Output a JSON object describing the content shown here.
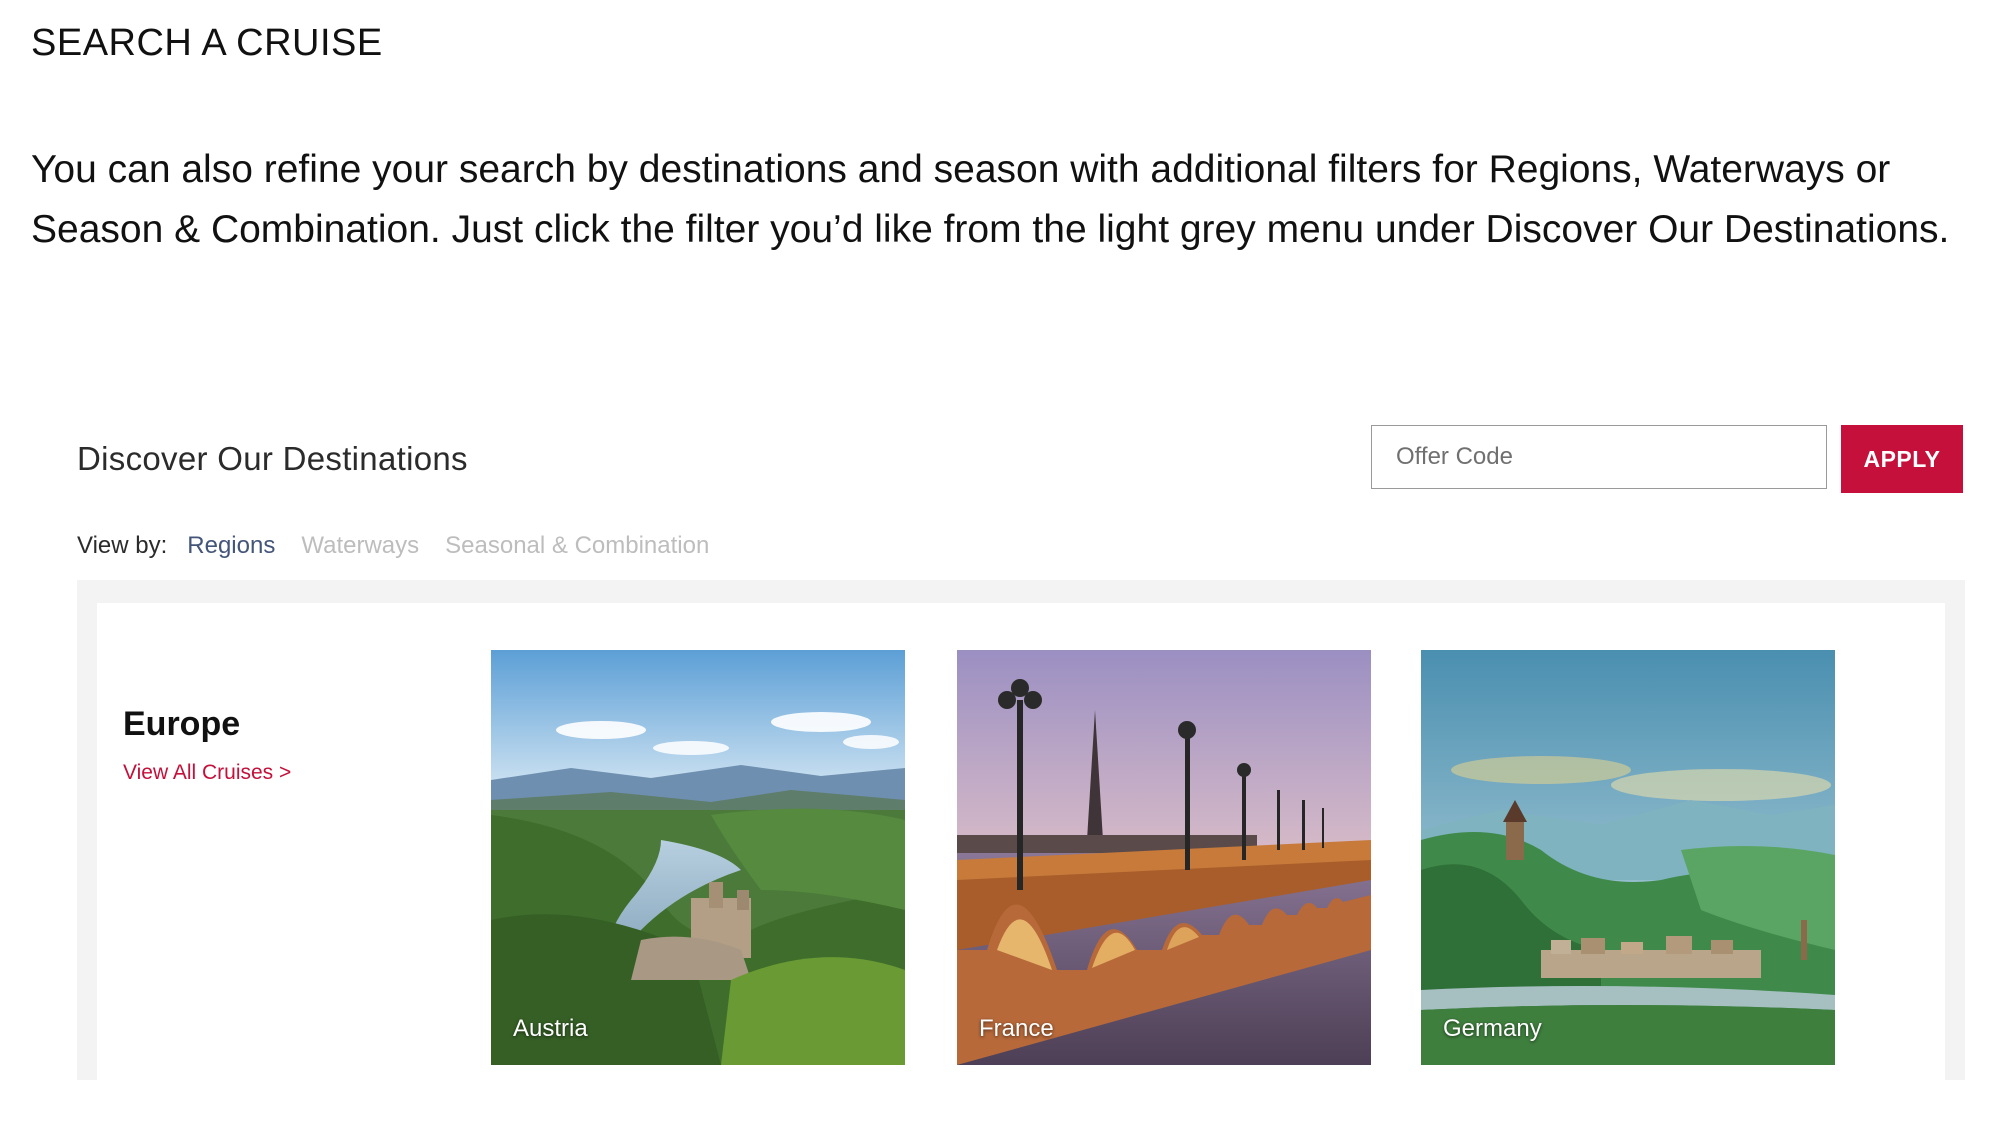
{
  "document": {
    "heading": "SEARCH A CRUISE",
    "paragraph": "You can also refine your search by destinations and season with additional filters for Regions, Waterways or Season & Combination. Just click the filter you’d like from the light grey menu under Discover Our Destinations."
  },
  "destinations": {
    "title": "Discover Our Destinations",
    "offer_code": {
      "placeholder": "Offer Code",
      "value": ""
    },
    "apply_label": "APPLY",
    "view_by": {
      "label": "View by:",
      "filters": [
        {
          "label": "Regions",
          "active": true
        },
        {
          "label": "Waterways",
          "active": false
        },
        {
          "label": "Seasonal & Combination",
          "active": false
        }
      ]
    },
    "region": {
      "name": "Europe",
      "view_all_label": "View All Cruises >"
    },
    "cards": [
      {
        "label": "Austria",
        "image": "austria-valley-river-castle"
      },
      {
        "label": "France",
        "image": "france-bridge-lampposts"
      },
      {
        "label": "Germany",
        "image": "germany-river-town-hills"
      }
    ]
  },
  "colors": {
    "accent": "#c4103a",
    "active_filter": "#44557a",
    "inactive_filter": "#bdbdbd",
    "panel_bg": "#f3f3f3"
  }
}
